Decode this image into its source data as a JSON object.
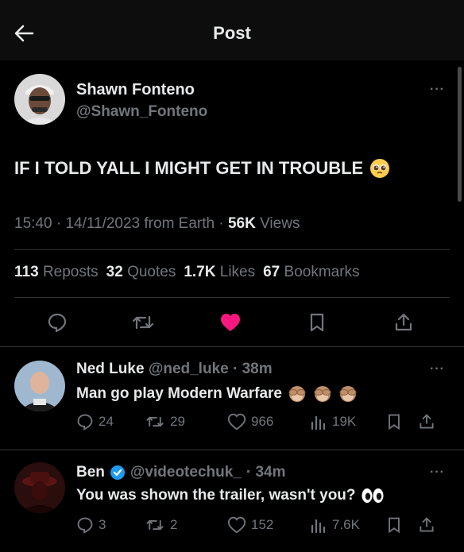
{
  "header": {
    "title": "Post"
  },
  "post": {
    "author_name": "Shawn Fonteno",
    "author_handle": "@Shawn_Fonteno",
    "text": "IF I TOLD YALL I MIGHT GET IN TROUBLE",
    "emoji_icon": "pleading-face-icon",
    "time": "15:40 · 14/11/2023 from Earth · ",
    "views_count": "56K",
    "views_label": " Views",
    "stats": {
      "reposts_count": "113",
      "reposts_label": "Reposts",
      "quotes_count": "32",
      "quotes_label": "Quotes",
      "likes_count": "1.7K",
      "likes_label": "Likes",
      "bookmarks_count": "67",
      "bookmarks_label": "Bookmarks"
    },
    "like_color": "#f91880"
  },
  "replies": [
    {
      "name": "Ned Luke",
      "handle": "@ned_luke",
      "time": "· 38m",
      "text": "Man go play Modern Warfare",
      "emoji_icons": [
        "see-no-evil-monkey-icon",
        "see-no-evil-monkey-icon",
        "see-no-evil-monkey-icon"
      ],
      "replies": "24",
      "reposts": "29",
      "likes": "966",
      "views": "19K"
    },
    {
      "name": "Ben",
      "verified": true,
      "handle": "@videotechuk_",
      "time": "· 34m",
      "text": "You was shown the trailer, wasn't you?",
      "emoji_icons": [
        "eyes-icon"
      ],
      "replies": "3",
      "reposts": "2",
      "likes": "152",
      "views": "7.6K"
    }
  ],
  "colors": {
    "background": "#000000",
    "muted": "#71767b",
    "verified": "#1d9bf0"
  }
}
